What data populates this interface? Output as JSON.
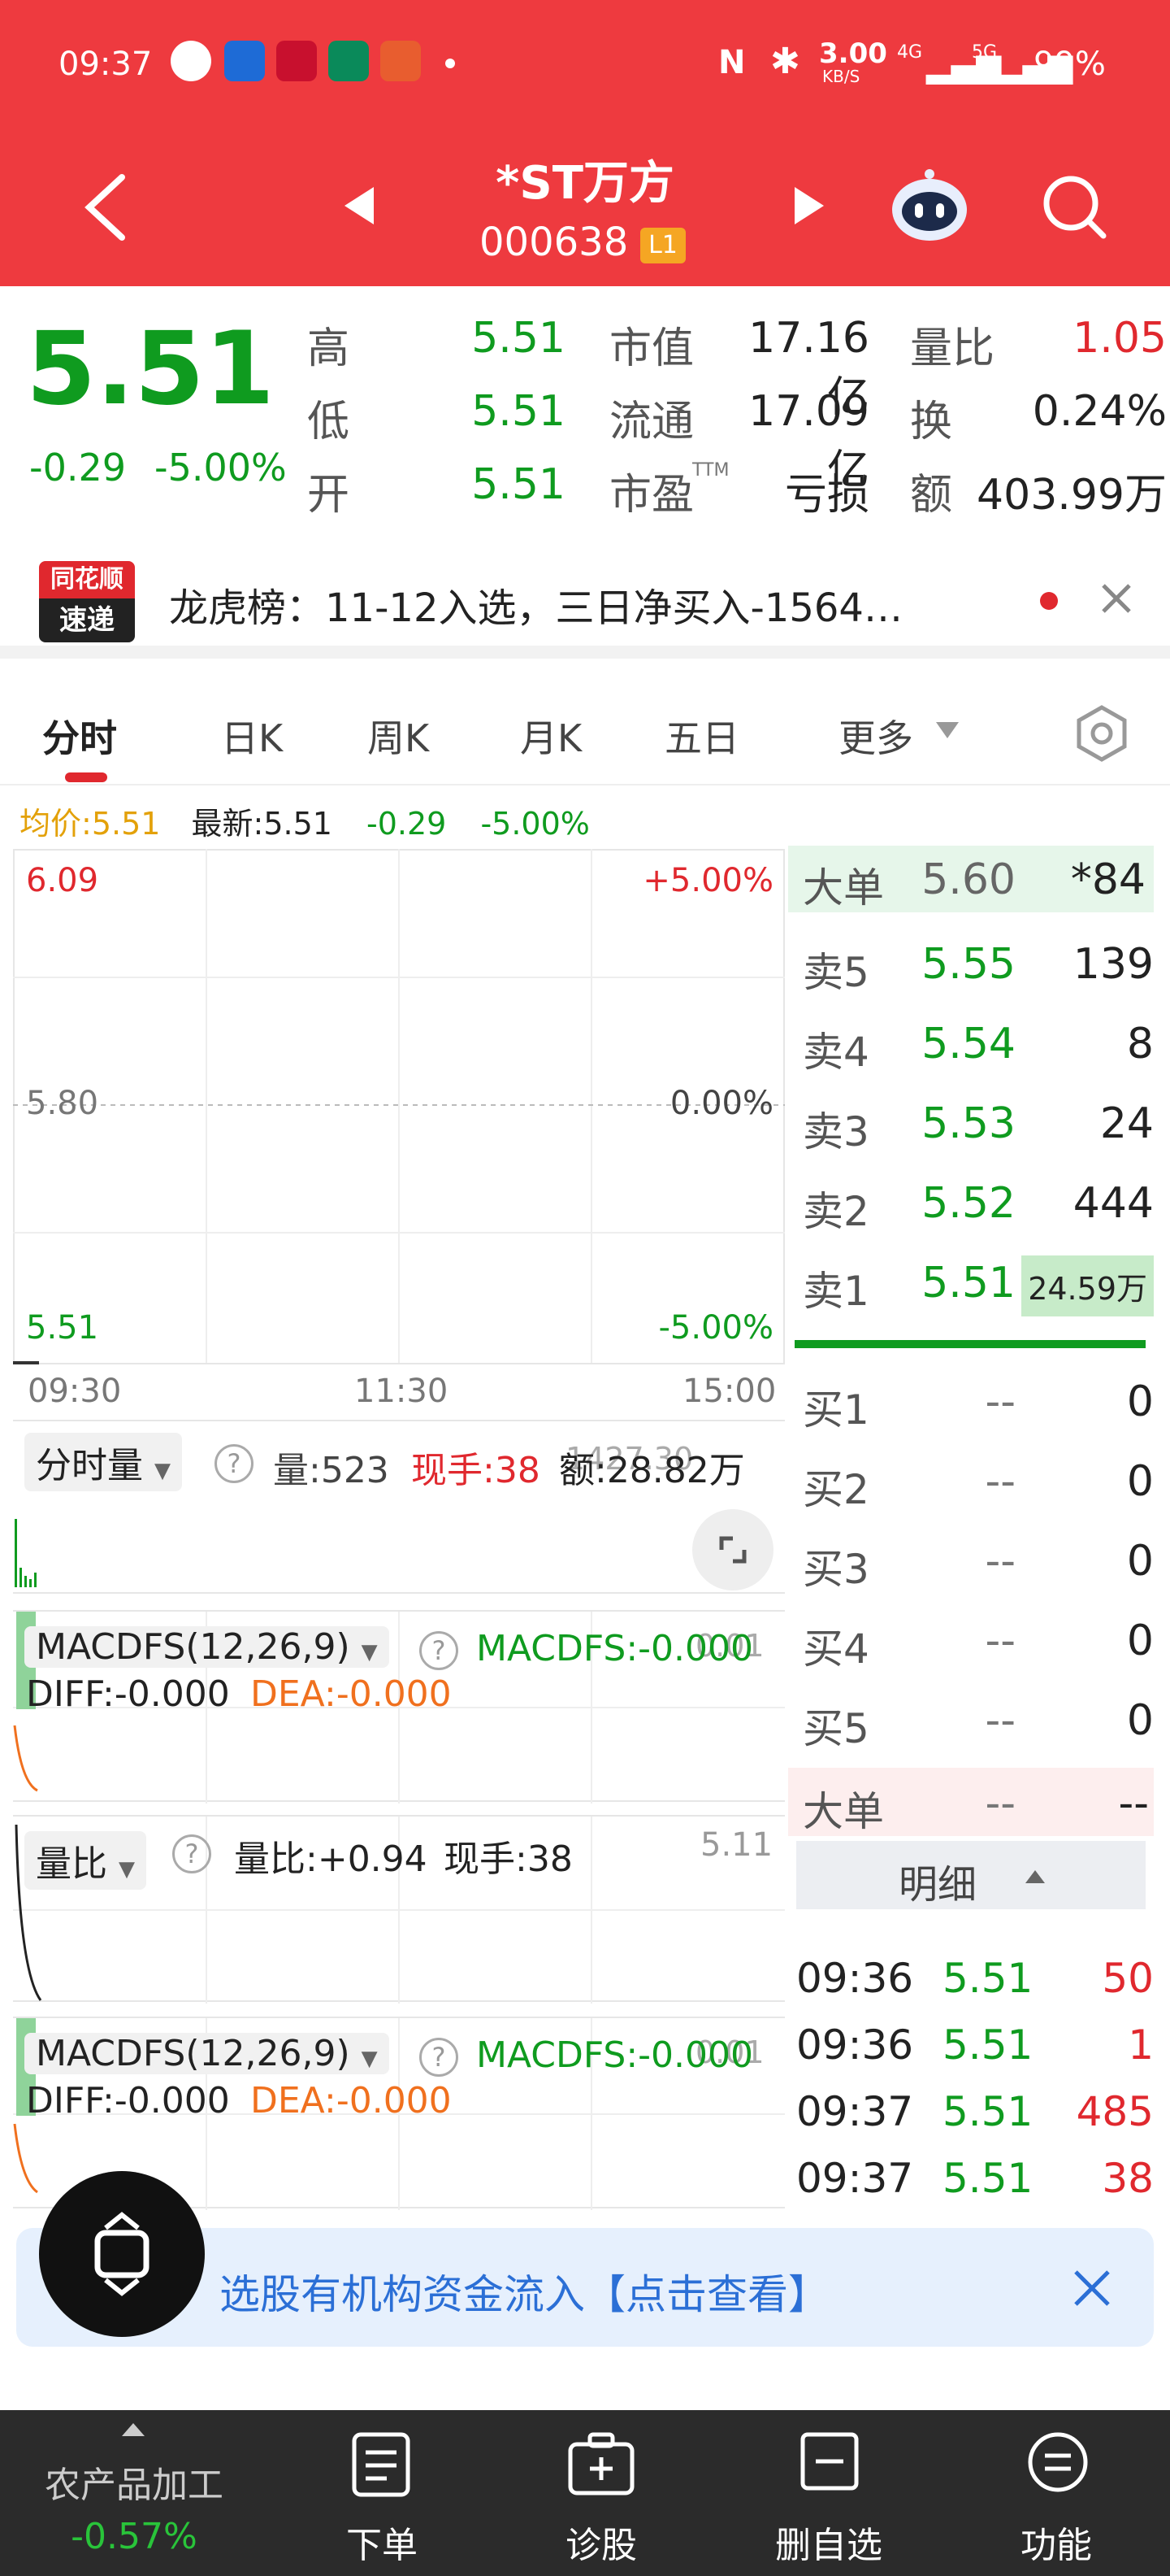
{
  "status": {
    "time": "09:37",
    "net_speed": "3.00",
    "net_unit": "KB/S",
    "signal1": "4G",
    "signal2": "5G",
    "battery": "99%"
  },
  "nav": {
    "title": "*ST万方",
    "code": "000638",
    "level": "L1"
  },
  "quote": {
    "price": "5.51",
    "change": "-0.29",
    "change_pct": "-5.00%",
    "high_label": "高",
    "high": "5.51",
    "low_label": "低",
    "low": "5.51",
    "open_label": "开",
    "open": "5.51",
    "mcap_label": "市值",
    "mcap": "17.16亿",
    "float_label": "流通",
    "float": "17.09亿",
    "pe_label": "市盈",
    "pe_sup": "TTM",
    "pe": "亏损",
    "vr_label": "量比",
    "vr": "1.05",
    "turn_label": "换",
    "turn": "0.24%",
    "amt_label": "额",
    "amt": "403.99万"
  },
  "news": {
    "logo_line1": "同花顺",
    "logo_line2": "速递",
    "text": "龙虎榜：11-12入选，三日净买入-1564…"
  },
  "tabs": [
    "分时",
    "日K",
    "周K",
    "月K",
    "五日",
    "更多"
  ],
  "info_line": {
    "avg_label": "均价:",
    "avg": "5.51",
    "latest_label": "最新:",
    "latest": "5.51",
    "chg": "-0.29",
    "pct": "-5.00%"
  },
  "chart": {
    "top_left": "6.09",
    "top_right": "+5.00%",
    "mid_left": "5.80",
    "mid_right": "0.00%",
    "bot_left": "5.51",
    "bot_right": "-5.00%",
    "times": [
      "09:30",
      "11:30",
      "15:00"
    ]
  },
  "book": {
    "big_label": "大单",
    "big_price": "5.60",
    "big_vol": "*84",
    "sells": [
      {
        "k": "卖5",
        "p": "5.55",
        "v": "139"
      },
      {
        "k": "卖4",
        "p": "5.54",
        "v": "8"
      },
      {
        "k": "卖3",
        "p": "5.53",
        "v": "24"
      },
      {
        "k": "卖2",
        "p": "5.52",
        "v": "444"
      },
      {
        "k": "卖1",
        "p": "5.51",
        "v": "24.59万"
      }
    ],
    "buys": [
      {
        "k": "买1",
        "p": "--",
        "v": "0"
      },
      {
        "k": "买2",
        "p": "--",
        "v": "0"
      },
      {
        "k": "买3",
        "p": "--",
        "v": "0"
      },
      {
        "k": "买4",
        "p": "--",
        "v": "0"
      },
      {
        "k": "买5",
        "p": "--",
        "v": "0"
      }
    ],
    "big2_label": "大单",
    "big2_price": "--",
    "big2_vol": "--",
    "detail_label": "明细"
  },
  "vol_panel": {
    "chip": "分时量",
    "vol": "量:523",
    "hand": "现手:38",
    "amount": "额:28.82万",
    "ghost": "1427.30"
  },
  "macd1": {
    "chip": "MACDFS(12,26,9)",
    "macd": "MACDFS:-0.000",
    "diff": "DIFF:-0.000",
    "dea": "DEA:-0.000",
    "ghost": "0.01"
  },
  "vr_panel": {
    "chip": "量比",
    "vr": "量比:+0.94",
    "hand": "现手:38",
    "right": "5.11"
  },
  "macd2": {
    "chip": "MACDFS(12,26,9)",
    "macd": "MACDFS:-0.000",
    "diff": "DIFF:-0.000",
    "dea": "DEA:-0.000",
    "ghost": "0.01"
  },
  "trades": [
    {
      "t": "09:36",
      "p": "5.51",
      "v": "50"
    },
    {
      "t": "09:36",
      "p": "5.51",
      "v": "1"
    },
    {
      "t": "09:37",
      "p": "5.51",
      "v": "485"
    },
    {
      "t": "09:37",
      "p": "5.51",
      "v": "38"
    }
  ],
  "banner": {
    "text": "选股有机构资金流入【点击查看】"
  },
  "bottom": {
    "sector": "农产品加工",
    "sector_chg": "-0.57%",
    "items": [
      "下单",
      "诊股",
      "删自选",
      "功能"
    ]
  }
}
